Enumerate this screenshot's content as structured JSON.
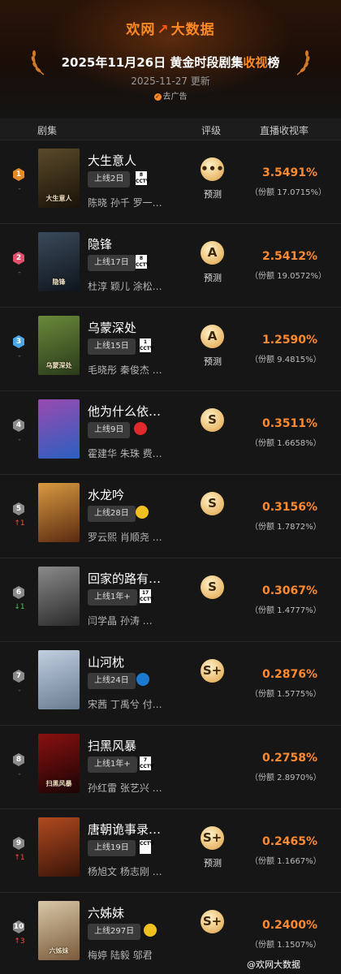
{
  "header": {
    "logo": "欢网",
    "logo_mark": "↗",
    "logo_suffix": "大数据",
    "title_main": "2025年11月26日 黄金时段剧集",
    "title_highlight": "收视",
    "title_end": "榜",
    "update": "2025-11-27 更新",
    "ad_link": "去广告"
  },
  "columns": {
    "show": "剧集",
    "grade": "评级",
    "rating": "直播收视率"
  },
  "rows": [
    {
      "rank": "1",
      "delta": "-",
      "delta_dir": "flat",
      "name": "大生意人",
      "days": "上线2日",
      "channel": "8\nCCTV",
      "cast": "陈晓 孙千 罗一…",
      "grade": "•••",
      "predict": "预测",
      "rating": "3.5491%",
      "share": "（份额 17.0715%）",
      "poster_text": "大生意人"
    },
    {
      "rank": "2",
      "delta": "-",
      "delta_dir": "flat",
      "name": "隐锋",
      "days": "上线17日",
      "channel": "8\nCCTV",
      "cast": "杜淳 颖儿 涂松…",
      "grade": "A",
      "predict": "预测",
      "rating": "2.5412%",
      "share": "（份额 19.0572%）",
      "poster_text": "隐锋"
    },
    {
      "rank": "3",
      "delta": "-",
      "delta_dir": "flat",
      "name": "乌蒙深处",
      "days": "上线15日",
      "channel": "1\nCCTV",
      "cast": "毛晓彤 秦俊杰 …",
      "grade": "A",
      "predict": "预测",
      "rating": "1.2590%",
      "share": "（份额 9.4815%）",
      "poster_text": "乌蒙深处"
    },
    {
      "rank": "4",
      "delta": "-",
      "delta_dir": "flat",
      "name": "他为什么依…",
      "days": "上线9日",
      "channel": "",
      "cast": "霍建华 朱珠 费…",
      "grade": "S",
      "predict": "",
      "rating": "0.3511%",
      "share": "（份额 1.6658%）",
      "poster_text": ""
    },
    {
      "rank": "5",
      "delta": "↑1",
      "delta_dir": "up",
      "name": "水龙吟",
      "days": "上线28日",
      "channel": "",
      "cast": "罗云熙 肖顺尧 …",
      "grade": "S",
      "predict": "",
      "rating": "0.3156%",
      "share": "（份额 1.7872%）",
      "poster_text": ""
    },
    {
      "rank": "6",
      "delta": "↓1",
      "delta_dir": "down",
      "name": "回家的路有…",
      "days": "上线1年+",
      "channel": "17\nCCTV",
      "cast": "闫学晶 孙涛 …",
      "grade": "S",
      "predict": "",
      "rating": "0.3067%",
      "share": "（份额 1.4777%）",
      "poster_text": ""
    },
    {
      "rank": "7",
      "delta": "-",
      "delta_dir": "flat",
      "name": "山河枕",
      "days": "上线24日",
      "channel": "",
      "cast": "宋茜 丁禹兮 付…",
      "grade": "S+",
      "predict": "",
      "rating": "0.2876%",
      "share": "（份额 1.5775%）",
      "poster_text": ""
    },
    {
      "rank": "8",
      "delta": "-",
      "delta_dir": "flat",
      "name": "扫黑风暴",
      "days": "上线1年+",
      "channel": "7\nCCTV",
      "cast": "孙红雷 张艺兴 …",
      "grade": "",
      "predict": "",
      "rating": "0.2758%",
      "share": "（份额 2.8970%）",
      "poster_text": "扫黑风暴"
    },
    {
      "rank": "9",
      "delta": "↑1",
      "delta_dir": "up",
      "name": "唐朝诡事录…",
      "days": "上线19日",
      "channel": "CCTV",
      "cast": "杨旭文 杨志刚 …",
      "grade": "S+",
      "predict": "预测",
      "rating": "0.2465%",
      "share": "（份额 1.1667%）",
      "poster_text": ""
    },
    {
      "rank": "10",
      "delta": "↑3",
      "delta_dir": "up",
      "name": "六姊妹",
      "days": "上线297日",
      "channel": "",
      "cast": "梅婷 陆毅 邬君",
      "grade": "S+",
      "predict": "",
      "rating": "0.2400%",
      "share": "（份额 1.1507%）",
      "poster_text": "六姊妹"
    }
  ],
  "watermark": "@欢网大数据",
  "colors": {
    "accent": "#ff8a30",
    "background": "#141414",
    "rank_badges": [
      "#e08a2a",
      "#e0506a",
      "#4aa8e8",
      "#8a8a8a",
      "#8a8a8a",
      "#8a8a8a",
      "#8a8a8a",
      "#8a8a8a",
      "#8a8a8a",
      "#8a8a8a"
    ]
  }
}
